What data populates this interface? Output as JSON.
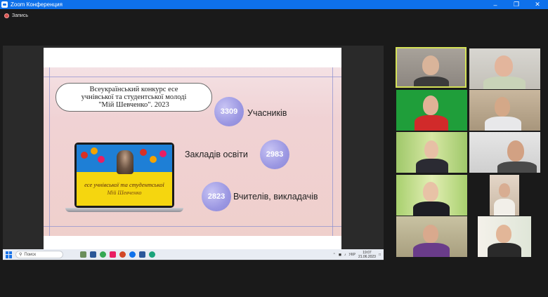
{
  "window": {
    "title": "Zoom Конференция"
  },
  "recording": {
    "label": "Запись"
  },
  "slide": {
    "title_line1": "Всеукраїнський конкурс есе",
    "title_line2": "учнівської та студентської молоді",
    "title_line3": "\"Мій Шевченко\". 2023",
    "stats": [
      {
        "value": "3309",
        "label": "Учасників"
      },
      {
        "value": "2983",
        "label": "Закладів освіти"
      },
      {
        "value": "2823",
        "label": "Вчителів, викладачів"
      }
    ],
    "laptop_text1": "есе учнівської та студентської",
    "laptop_text2": "Мій Шевченко"
  },
  "taskbar": {
    "search_placeholder": "Поиск",
    "lang": "УКР",
    "time": "19:07",
    "date": "21.06.2023"
  },
  "colors": {
    "zoom_blue": "#0e71eb",
    "active_speaker_border": "#d4e157",
    "stat_circle": "#9b97e2"
  }
}
